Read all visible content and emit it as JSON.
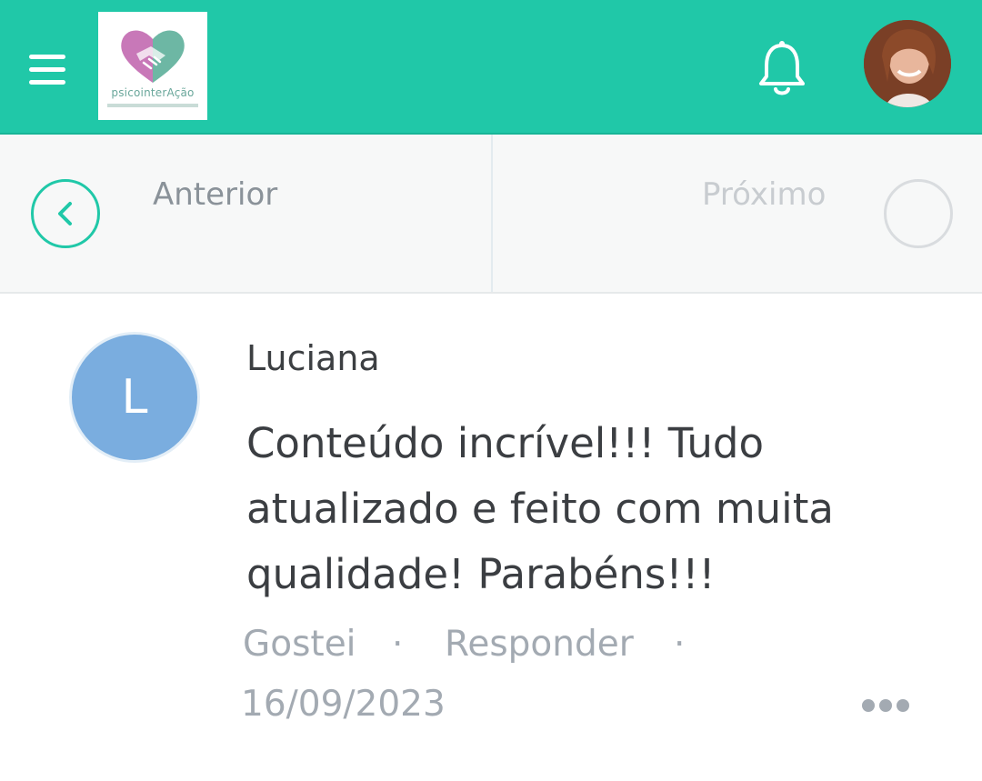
{
  "header": {
    "logo_text": "psicointerAção",
    "colors": {
      "bar": "#20c8a8",
      "accent": "#20c8a8"
    },
    "icons": [
      "menu-icon",
      "bell-icon",
      "profile-photo"
    ]
  },
  "navigation": {
    "previous_label": "Anterior",
    "next_label": "Próximo"
  },
  "comment": {
    "avatar_initial": "L",
    "author": "Luciana",
    "text": "Conteúdo incrível!!! Tudo atualizado e feito com muita qualidade! Parabéns!!!",
    "like_label": "Gostei",
    "separator": "·",
    "reply_label": "Responder",
    "date": "16/09/2023",
    "avatar_color": "#7aaddf"
  }
}
